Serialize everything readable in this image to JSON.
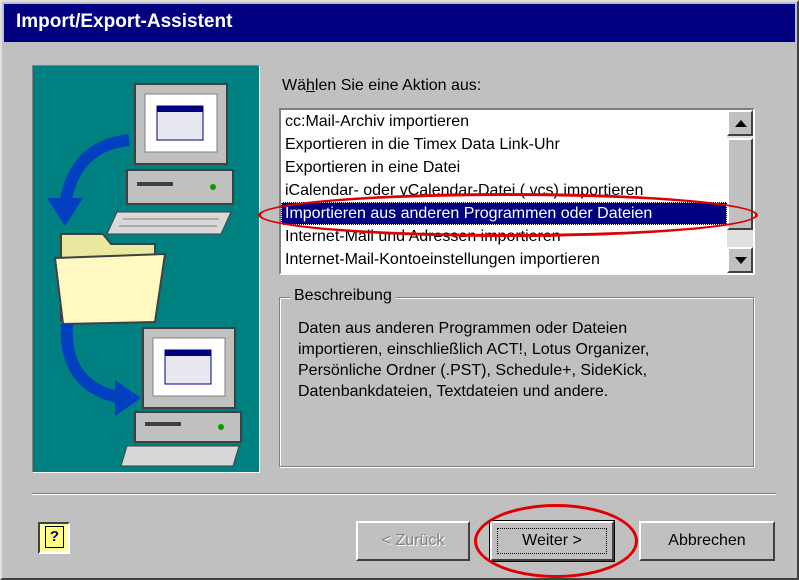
{
  "window": {
    "title": "Import/Export-Assistent"
  },
  "prompt": {
    "label": "Wählen Sie eine Aktion aus:"
  },
  "actions": {
    "items": [
      "cc:Mail-Archiv importieren",
      "Exportieren in die Timex Data Link-Uhr",
      "Exportieren in eine Datei",
      "iCalendar- oder vCalendar-Datei (.vcs) importieren",
      "Importieren aus anderen Programmen oder Dateien",
      "Internet-Mail und Adressen importieren",
      "Internet-Mail-Kontoeinstellungen importieren"
    ],
    "selected": "Importieren aus anderen Programmen oder Dateien"
  },
  "description": {
    "legend": "Beschreibung",
    "lines": [
      "Daten aus anderen Programmen oder Dateien",
      "importieren, einschließlich ACT!, Lotus Organizer,",
      "Persönliche Ordner (.PST), Schedule+, SideKick,",
      "Datenbankdateien, Textdateien und andere."
    ]
  },
  "buttons": {
    "help": "?",
    "back": "< Zurück",
    "next": "Weiter >",
    "cancel": "Abbrechen"
  },
  "icons": [
    "computer-icon",
    "folder-icon",
    "arrow-icon",
    "help-icon",
    "scroll-up-icon",
    "scroll-down-icon"
  ],
  "colors": {
    "titlebar": "#000080",
    "dialog": "#c0c0c0",
    "illustration": "#008080",
    "selection": "#000080",
    "highlight_ellipse": "#e00000"
  }
}
